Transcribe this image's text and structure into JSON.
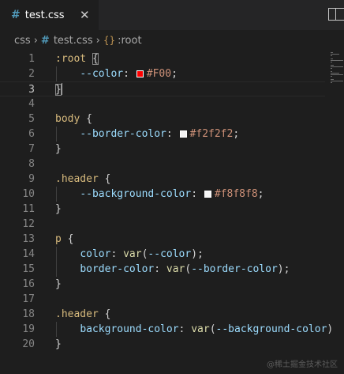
{
  "tab": {
    "icon": "#",
    "filename": "test.css",
    "close": "✕"
  },
  "breadcrumb": {
    "folder": "css",
    "sep1": "›",
    "file_icon": "#",
    "file": "test.css",
    "sep2": "›",
    "symbol_icon": "{}",
    "symbol": ":root"
  },
  "watermark": "@稀土掘金技术社区",
  "editor": {
    "current_line": 3,
    "lines": [
      {
        "n": "1",
        "tokens": [
          [
            "sel",
            ":root"
          ],
          [
            "punc",
            " "
          ],
          [
            "bracket",
            "{"
          ]
        ]
      },
      {
        "n": "2",
        "tokens": [
          [
            "ws",
            "    "
          ],
          [
            "prop",
            "--color"
          ],
          [
            "punc",
            ": "
          ],
          [
            "swatch",
            "#FF0000"
          ],
          [
            "val",
            "#F00"
          ],
          [
            "punc",
            ";"
          ]
        ]
      },
      {
        "n": "3",
        "tokens": [
          [
            "bracket",
            "}"
          ],
          [
            "cursor",
            ""
          ]
        ]
      },
      {
        "n": "4",
        "tokens": []
      },
      {
        "n": "5",
        "tokens": [
          [
            "sel",
            "body"
          ],
          [
            "punc",
            " {"
          ]
        ]
      },
      {
        "n": "6",
        "tokens": [
          [
            "ws",
            "    "
          ],
          [
            "prop",
            "--border-color"
          ],
          [
            "punc",
            ": "
          ],
          [
            "swatch",
            "#f2f2f2"
          ],
          [
            "val",
            "#f2f2f2"
          ],
          [
            "punc",
            ";"
          ]
        ]
      },
      {
        "n": "7",
        "tokens": [
          [
            "punc",
            "}"
          ]
        ]
      },
      {
        "n": "8",
        "tokens": []
      },
      {
        "n": "9",
        "tokens": [
          [
            "sel",
            ".header"
          ],
          [
            "punc",
            " {"
          ]
        ]
      },
      {
        "n": "10",
        "tokens": [
          [
            "ws",
            "    "
          ],
          [
            "prop",
            "--background-color"
          ],
          [
            "punc",
            ": "
          ],
          [
            "swatch",
            "#f8f8f8"
          ],
          [
            "val",
            "#f8f8f8"
          ],
          [
            "punc",
            ";"
          ]
        ]
      },
      {
        "n": "11",
        "tokens": [
          [
            "punc",
            "}"
          ]
        ]
      },
      {
        "n": "12",
        "tokens": []
      },
      {
        "n": "13",
        "tokens": [
          [
            "sel",
            "p"
          ],
          [
            "punc",
            " {"
          ]
        ]
      },
      {
        "n": "14",
        "tokens": [
          [
            "ws",
            "    "
          ],
          [
            "prop",
            "color"
          ],
          [
            "punc",
            ": "
          ],
          [
            "fn",
            "var"
          ],
          [
            "punc",
            "("
          ],
          [
            "prop",
            "--color"
          ],
          [
            "punc",
            ");"
          ]
        ]
      },
      {
        "n": "15",
        "tokens": [
          [
            "ws",
            "    "
          ],
          [
            "prop",
            "border-color"
          ],
          [
            "punc",
            ": "
          ],
          [
            "fn",
            "var"
          ],
          [
            "punc",
            "("
          ],
          [
            "prop",
            "--border-color"
          ],
          [
            "punc",
            ");"
          ]
        ]
      },
      {
        "n": "16",
        "tokens": [
          [
            "punc",
            "}"
          ]
        ]
      },
      {
        "n": "17",
        "tokens": []
      },
      {
        "n": "18",
        "tokens": [
          [
            "sel",
            ".header"
          ],
          [
            "punc",
            " {"
          ]
        ]
      },
      {
        "n": "19",
        "tokens": [
          [
            "ws",
            "    "
          ],
          [
            "prop",
            "background-color"
          ],
          [
            "punc",
            ": "
          ],
          [
            "fn",
            "var"
          ],
          [
            "punc",
            "("
          ],
          [
            "prop",
            "--background-color"
          ],
          [
            "punc",
            ")"
          ]
        ]
      },
      {
        "n": "20",
        "tokens": [
          [
            "punc",
            "}"
          ]
        ]
      }
    ]
  }
}
